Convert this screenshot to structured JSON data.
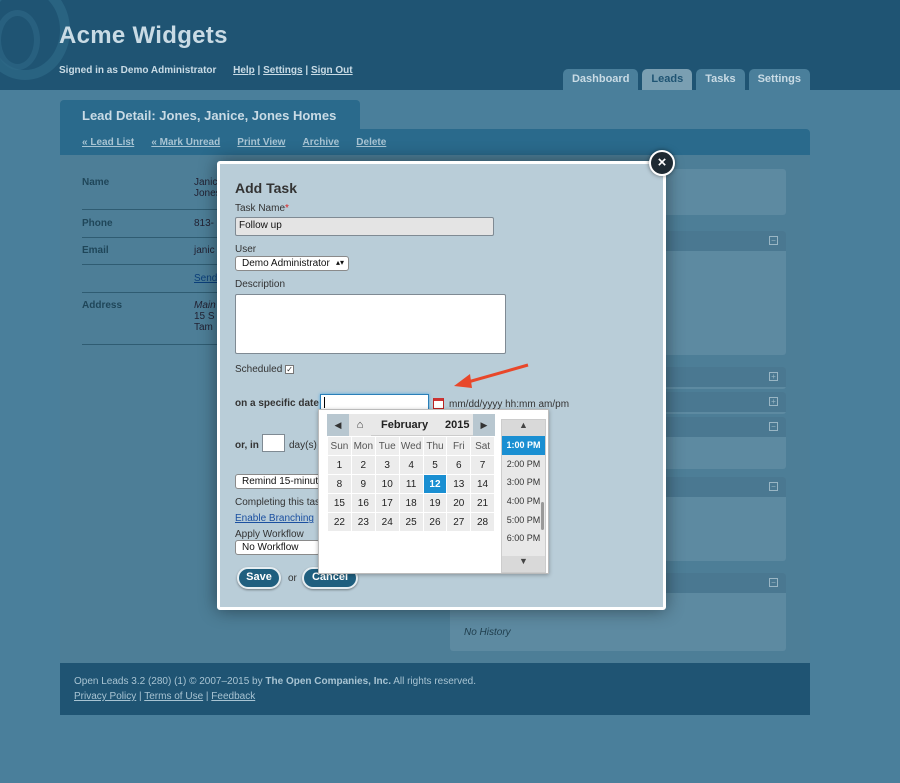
{
  "app": {
    "brand": "Acme Widgets",
    "signed_in": "Signed in as Demo Administrator",
    "links": [
      "Help",
      "Settings",
      "Sign Out"
    ],
    "tabs": [
      {
        "label": "Dashboard",
        "active": false
      },
      {
        "label": "Leads",
        "active": true
      },
      {
        "label": "Tasks",
        "active": false
      },
      {
        "label": "Settings",
        "active": false
      }
    ]
  },
  "lead": {
    "title": "Lead Detail: Jones, Janice, Jones Homes",
    "actions": [
      "« Lead List",
      "« Mark Unread",
      "Print View",
      "Archive",
      "Delete"
    ],
    "fields": [
      {
        "label": "Name",
        "value1": "Janic",
        "value2": "Jones"
      },
      {
        "label": "Phone",
        "value1": "813-",
        "value2": ""
      },
      {
        "label": "Email",
        "value1": "janic",
        "value2": ""
      },
      {
        "label": "",
        "value1": "Send",
        "value2": ""
      },
      {
        "label": "Address",
        "value1": "Main",
        "value2": "15 S",
        "value3": "Tam"
      }
    ],
    "no_history": "No History"
  },
  "modal": {
    "title": "Add Task",
    "task_name_label": "Task Name",
    "task_name_required": "*",
    "task_name_value": "Follow up",
    "user_label": "User",
    "user_value": "Demo Administrator",
    "description_label": "Description",
    "scheduled_label": "Scheduled",
    "scheduled_checked": "✓",
    "specific_date_label": "on a specific date",
    "date_format_hint": "mm/dd/yyyy hh:mm am/pm",
    "or_in_label": "or, in",
    "days_label": "day(s)",
    "remind_value": "Remind 15-minut",
    "completing_text": "Completing this tas",
    "enable_branching": "Enable Branching",
    "apply_workflow_label": "Apply Workflow",
    "workflow_value": "No Workflow",
    "save_label": "Save",
    "or_text": "or",
    "cancel_label": "Cancel",
    "close_icon": "×"
  },
  "calendar": {
    "month": "February",
    "year": "2015",
    "weekdays": [
      "Sun",
      "Mon",
      "Tue",
      "Wed",
      "Thu",
      "Fri",
      "Sat"
    ],
    "weeks": [
      [
        "1",
        "2",
        "3",
        "4",
        "5",
        "6",
        "7"
      ],
      [
        "8",
        "9",
        "10",
        "11",
        "12",
        "13",
        "14"
      ],
      [
        "15",
        "16",
        "17",
        "18",
        "19",
        "20",
        "21"
      ],
      [
        "22",
        "23",
        "24",
        "25",
        "26",
        "27",
        "28"
      ]
    ],
    "selected_day": "12",
    "times": [
      "1:00 PM",
      "2:00 PM",
      "3:00 PM",
      "4:00 PM",
      "5:00 PM",
      "6:00 PM"
    ],
    "selected_time": "1:00 PM",
    "selection_color": "#1a8fd2"
  },
  "footer": {
    "line1": "Open Leads 3.2 (280) (1) © 2007–2015 by",
    "company": "The Open Companies, Inc.",
    "rights": "All rights reserved.",
    "links": [
      "Privacy Policy",
      "Terms of Use",
      "Feedback"
    ]
  },
  "annotation": {
    "arrow_color": "#e8472a"
  }
}
